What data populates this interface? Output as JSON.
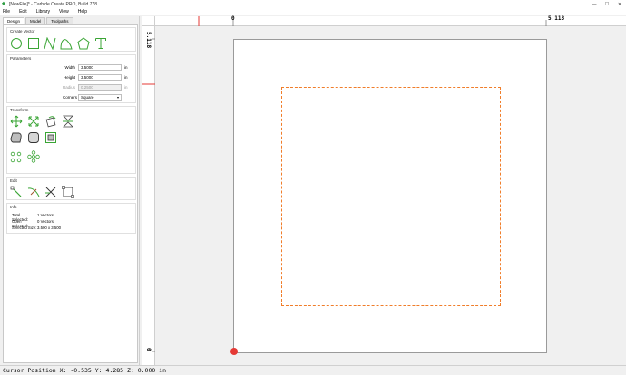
{
  "window": {
    "title": "[NewFile]* - Carbide Create PRO, Build 778",
    "minimize": "—",
    "maximize": "☐",
    "close": "✕"
  },
  "menu": [
    "File",
    "Edit",
    "Library",
    "View",
    "Help"
  ],
  "tabs": [
    "Design",
    "Model",
    "Toolpaths"
  ],
  "create_vector": {
    "title": "Create Vector",
    "tools": [
      "circle-icon",
      "rectangle-icon",
      "polyline-icon",
      "curve-icon",
      "polygon-icon",
      "text-icon"
    ]
  },
  "parameters": {
    "title": "Parameters",
    "width_label": "Width",
    "width_value": "3.5000",
    "width_unit": "in",
    "height_label": "Height",
    "height_value": "3.5000",
    "height_unit": "in",
    "radius_label": "Radius",
    "radius_value": "0.2500",
    "radius_unit": "in",
    "corners_label": "Corners",
    "corners_value": "Square"
  },
  "transform": {
    "title": "Transform",
    "tools": [
      "move-icon",
      "scale-icon",
      "rotate-icon",
      "mirror-icon",
      "offset-icon",
      "fillet-icon",
      "inset-icon",
      "align-icon",
      "array-icon"
    ]
  },
  "edit": {
    "title": "Edit",
    "tools": [
      "node-edit-icon",
      "trim-icon",
      "cut-icon",
      "boolean-icon"
    ]
  },
  "info": {
    "title": "Info",
    "total_selected_label": "Total Selected:",
    "total_selected_value": "1 Vectors",
    "open_selected_label": "Open Selected:",
    "open_selected_value": "0 Vectors",
    "selected_size_label": "Selected Size:",
    "selected_size_value": "3.500 x 3.500"
  },
  "rulers": {
    "top_zero": "0",
    "top_max": "5.118",
    "left_max": "5.118",
    "left_zero": "0"
  },
  "colors": {
    "accent_green": "#3aa535",
    "selection_orange": "#f07d2a",
    "origin_red": "#e53935"
  },
  "status": {
    "cursor": "Cursor Position X: -0.535 Y: 4.285 Z: 0.000 in"
  }
}
